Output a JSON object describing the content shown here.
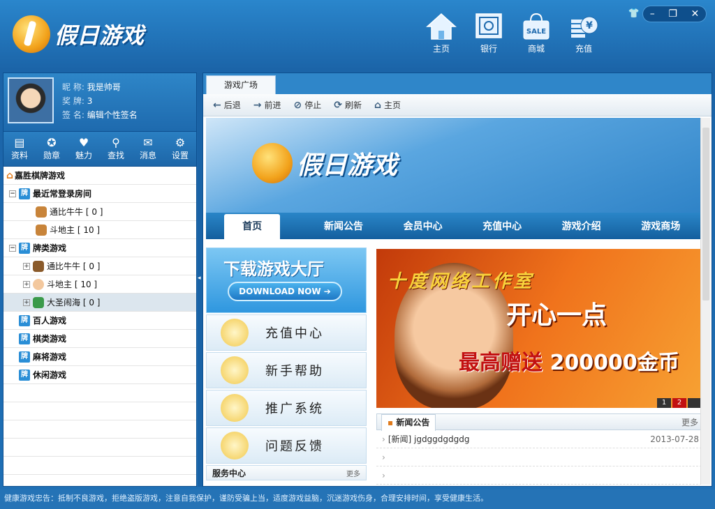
{
  "app": {
    "title": "假日游戏"
  },
  "topnav": [
    {
      "label": "主页",
      "icon": "home-icon"
    },
    {
      "label": "银行",
      "icon": "safe-icon"
    },
    {
      "label": "商城",
      "icon": "shop-bag-icon",
      "badge": "SALE"
    },
    {
      "label": "充值",
      "icon": "coins-icon",
      "badge": "¥"
    }
  ],
  "window_controls": {
    "minimize": "–",
    "restore": "❐",
    "close": "✕",
    "skin": "👕"
  },
  "profile": {
    "nickname_label": "昵  称:",
    "nickname": "我是帅哥",
    "medal_label": "奖  牌:",
    "medal": "3",
    "sign_label": "签  名:",
    "sign": "编辑个性签名"
  },
  "tools": [
    {
      "label": "资料",
      "icon": "profile-icon",
      "glyph": "▤"
    },
    {
      "label": "勋章",
      "icon": "medal-icon",
      "glyph": "✪"
    },
    {
      "label": "魅力",
      "icon": "heart-icon",
      "glyph": "♥"
    },
    {
      "label": "查找",
      "icon": "search-icon",
      "glyph": "⚲"
    },
    {
      "label": "消息",
      "icon": "message-icon",
      "glyph": "✉"
    },
    {
      "label": "设置",
      "icon": "gear-icon",
      "glyph": "⚙"
    }
  ],
  "tree": {
    "root": "嘉胜棋牌游戏",
    "recent": {
      "label": "最近常登录房间",
      "items": [
        {
          "name": "通比牛牛",
          "count": "[ 0 ]"
        },
        {
          "name": "斗地主",
          "count": "[ 10 ]"
        }
      ]
    },
    "cards": {
      "label": "牌类游戏",
      "items": [
        {
          "name": "通比牛牛",
          "count": "[ 0 ]"
        },
        {
          "name": "斗地主",
          "count": "[ 10 ]"
        },
        {
          "name": "大圣闹海",
          "count": "[ 0 ]"
        }
      ]
    },
    "others": [
      "百人游戏",
      "棋类游戏",
      "麻将游戏",
      "休闲游戏"
    ],
    "pai": "牌"
  },
  "browser": {
    "tab": "游戏广场",
    "nav": [
      {
        "label": "后退",
        "glyph": "🡐",
        "icon": "back-arrow-icon"
      },
      {
        "label": "前进",
        "glyph": "🡒",
        "icon": "forward-arrow-icon"
      },
      {
        "label": "停止",
        "glyph": "⊘",
        "icon": "stop-icon"
      },
      {
        "label": "刷新",
        "glyph": "⟳",
        "icon": "refresh-icon"
      },
      {
        "label": "主页",
        "glyph": "⌂",
        "icon": "home-icon"
      }
    ]
  },
  "site": {
    "logo": "假日游戏",
    "menu": [
      "首页",
      "新闻公告",
      "会员中心",
      "充值中心",
      "游戏介绍",
      "游戏商场"
    ],
    "download": {
      "title": "下载游戏大厅",
      "button": "DOWNLOAD NOW ➔"
    },
    "side_links": [
      "充值中心",
      "新手帮助",
      "推广系统",
      "问题反馈"
    ],
    "service": {
      "label": "服务中心",
      "more": "更多"
    },
    "ad": {
      "line1": "十度网络工作室",
      "line2": "开心一点",
      "line3a": "最高赠送",
      "line3b": " 200000金币",
      "pages": [
        "1",
        "2"
      ],
      "active_page": "2"
    },
    "news": {
      "title": "新闻公告",
      "more": "更多",
      "items": [
        {
          "text": "[新闻] jgdggdgdgdg",
          "date": "2013-07-28"
        },
        {
          "text": "",
          "date": ""
        },
        {
          "text": "",
          "date": ""
        }
      ]
    }
  },
  "status": "健康游戏忠告：抵制不良游戏，拒绝盗版游戏，注意自我保护，谨防受骗上当，适度游戏益脑，沉迷游戏伤身，合理安排时间，享受健康生活。",
  "colors": {
    "brand_blue": "#1f6fb0",
    "accent_orange": "#f0731c"
  }
}
